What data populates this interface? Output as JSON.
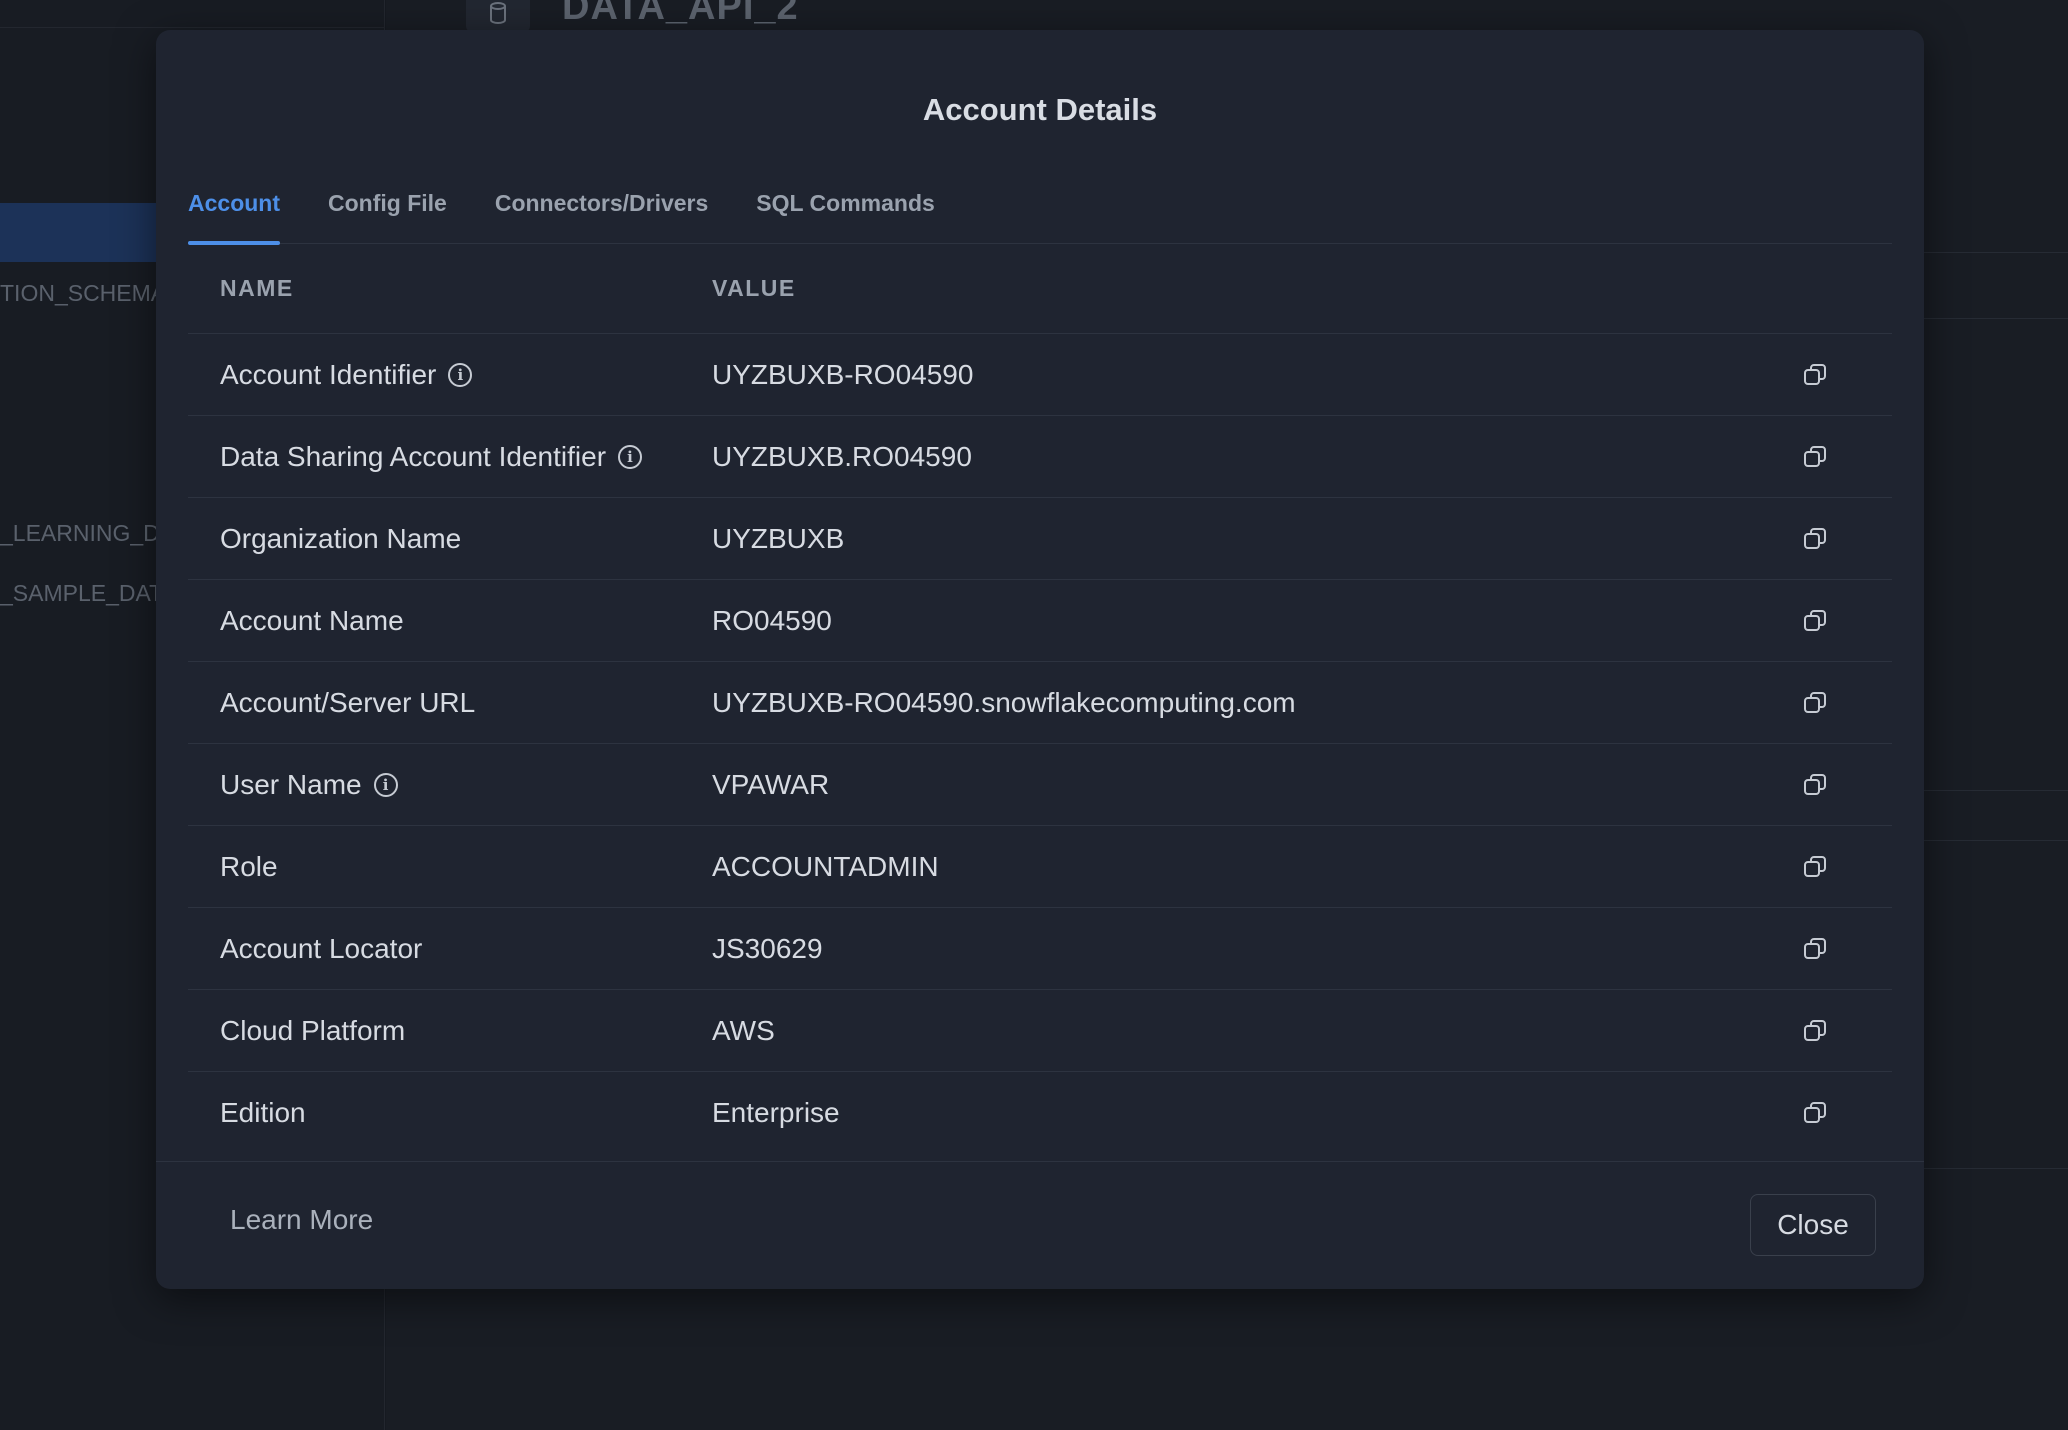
{
  "background": {
    "db_title": "DATA_API_2",
    "sidebar_items": [
      "TION_SCHEMA",
      "_LEARNING_D",
      "_SAMPLE_DAT"
    ]
  },
  "modal": {
    "title": "Account Details",
    "tabs": [
      {
        "label": "Account",
        "active": true
      },
      {
        "label": "Config File",
        "active": false
      },
      {
        "label": "Connectors/Drivers",
        "active": false
      },
      {
        "label": "SQL Commands",
        "active": false
      }
    ],
    "table": {
      "headers": {
        "name": "NAME",
        "value": "VALUE"
      },
      "rows": [
        {
          "name": "Account Identifier",
          "value": "UYZBUXB-RO04590",
          "info": true
        },
        {
          "name": "Data Sharing Account Identifier",
          "value": "UYZBUXB.RO04590",
          "info": true
        },
        {
          "name": "Organization Name",
          "value": "UYZBUXB",
          "info": false
        },
        {
          "name": "Account Name",
          "value": "RO04590",
          "info": false
        },
        {
          "name": "Account/Server URL",
          "value": "UYZBUXB-RO04590.snowflakecomputing.com",
          "info": false
        },
        {
          "name": "User Name",
          "value": "VPAWAR",
          "info": true
        },
        {
          "name": "Role",
          "value": "ACCOUNTADMIN",
          "info": false
        },
        {
          "name": "Account Locator",
          "value": "JS30629",
          "info": false
        },
        {
          "name": "Cloud Platform",
          "value": "AWS",
          "info": false
        },
        {
          "name": "Edition",
          "value": "Enterprise",
          "info": false
        }
      ]
    },
    "footer": {
      "learn_more": "Learn More",
      "close": "Close"
    }
  },
  "icons": {
    "info": "info-circle-icon",
    "copy": "copy-icon",
    "database": "database-icon"
  },
  "colors": {
    "accent": "#4d8fe8",
    "modal_bg": "#1f2430",
    "page_bg": "#161a21"
  }
}
